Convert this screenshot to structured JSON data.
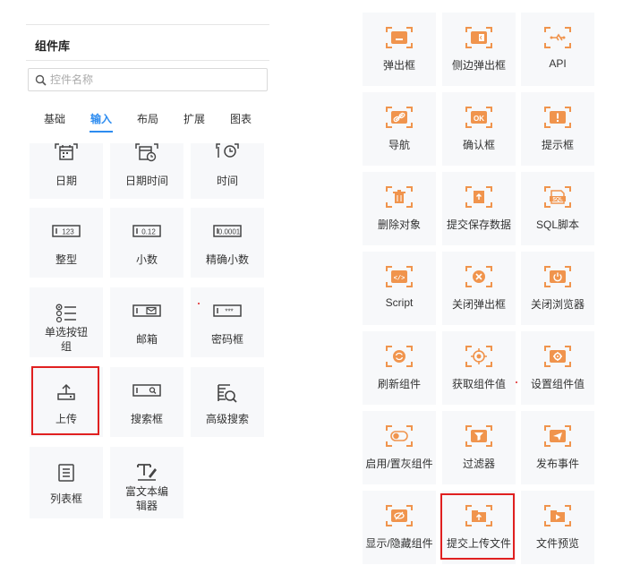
{
  "panel": {
    "title": "组件库",
    "search_placeholder": "控件名称",
    "tabs": [
      "基础",
      "输入",
      "布局",
      "扩展",
      "图表"
    ],
    "active_tab": "输入"
  },
  "left_components": [
    {
      "label": "日期",
      "icon": "calendar-icon"
    },
    {
      "label": "日期时间",
      "icon": "calendar-clock-icon"
    },
    {
      "label": "时间",
      "icon": "clock-icon"
    },
    {
      "label": "整型",
      "icon": "integer-field-icon",
      "icon_text": "123"
    },
    {
      "label": "小数",
      "icon": "decimal-field-icon",
      "icon_text": "0.12"
    },
    {
      "label": "精确小数",
      "icon": "precise-decimal-icon",
      "icon_text": "0.0001"
    },
    {
      "label": "单选按钮组",
      "icon": "radio-list-icon"
    },
    {
      "label": "邮箱",
      "icon": "email-field-icon"
    },
    {
      "label": "密码框",
      "icon": "password-field-icon",
      "icon_text": "***"
    },
    {
      "label": "上传",
      "icon": "upload-icon"
    },
    {
      "label": "搜索框",
      "icon": "search-field-icon"
    },
    {
      "label": "高级搜索",
      "icon": "advanced-search-icon"
    },
    {
      "label": "列表框",
      "icon": "listbox-icon"
    },
    {
      "label": "富文本编辑器",
      "icon": "rich-text-icon"
    }
  ],
  "right_components": [
    {
      "label": "弹出框",
      "icon": "popup-icon"
    },
    {
      "label": "侧边弹出框",
      "icon": "side-popup-icon"
    },
    {
      "label": "API",
      "icon": "api-icon"
    },
    {
      "label": "导航",
      "icon": "link-icon"
    },
    {
      "label": "确认框",
      "icon": "confirm-icon",
      "icon_text": "OK"
    },
    {
      "label": "提示框",
      "icon": "alert-icon",
      "icon_text": "!"
    },
    {
      "label": "删除对象",
      "icon": "trash-icon"
    },
    {
      "label": "提交保存数据",
      "icon": "submit-save-icon"
    },
    {
      "label": "SQL脚本",
      "icon": "sql-icon",
      "icon_text": "SQL"
    },
    {
      "label": "Script",
      "icon": "script-icon",
      "icon_text": "</>"
    },
    {
      "label": "关闭弹出框",
      "icon": "close-popup-icon"
    },
    {
      "label": "关闭浏览器",
      "icon": "power-icon"
    },
    {
      "label": "刷新组件",
      "icon": "refresh-icon"
    },
    {
      "label": "获取组件值",
      "icon": "target-icon"
    },
    {
      "label": "设置组件值",
      "icon": "gear-icon"
    },
    {
      "label": "启用/置灰组件",
      "icon": "toggle-icon"
    },
    {
      "label": "过滤器",
      "icon": "filter-icon"
    },
    {
      "label": "发布事件",
      "icon": "send-icon"
    },
    {
      "label": "显示/隐藏组件",
      "icon": "eye-off-icon"
    },
    {
      "label": "提交上传文件",
      "icon": "submit-upload-icon"
    },
    {
      "label": "文件预览",
      "icon": "file-preview-icon"
    }
  ],
  "colors": {
    "accent": "#2d8cf0",
    "action_icon": "#f0944d",
    "highlight": "#e02020",
    "tile_bg": "#f7f8fa"
  }
}
